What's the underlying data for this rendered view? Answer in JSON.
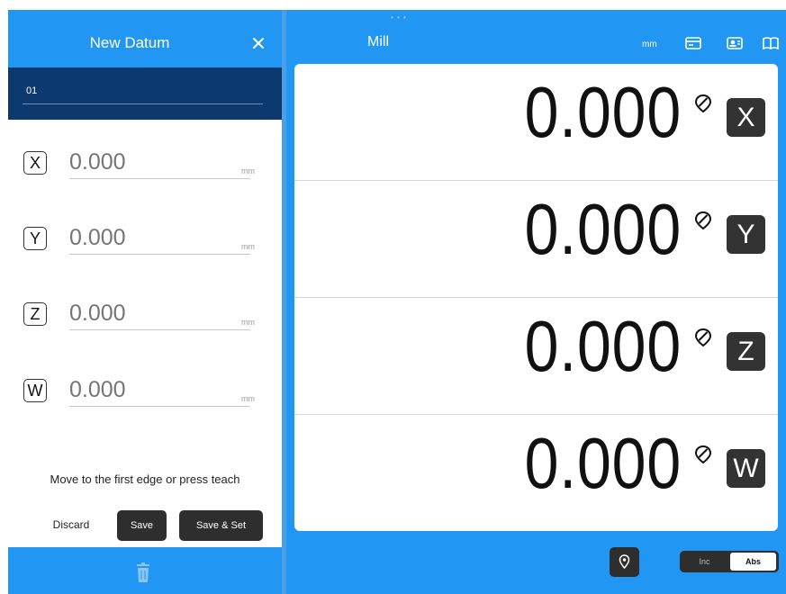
{
  "datum_panel": {
    "title": "New Datum",
    "name_value": "01",
    "axes": [
      {
        "label": "X",
        "placeholder": "0.000",
        "unit": "mm"
      },
      {
        "label": "Y",
        "placeholder": "0.000",
        "unit": "mm"
      },
      {
        "label": "Z",
        "placeholder": "0.000",
        "unit": "mm"
      },
      {
        "label": "W",
        "placeholder": "0.000",
        "unit": "mm"
      }
    ],
    "instruction": "Move to the first edge or press teach",
    "discard_label": "Discard",
    "save_label": "Save",
    "save_set_label": "Save & Set",
    "footer_icon": "trash-icon"
  },
  "main": {
    "title": "Mill",
    "unit_toggle": "mm",
    "toolbar_icons": [
      "card-icon",
      "camera-card-icon",
      "book-icon"
    ],
    "readouts": [
      {
        "value": "0.000",
        "axis": "X"
      },
      {
        "value": "0.000",
        "axis": "Y"
      },
      {
        "value": "0.000",
        "axis": "Z"
      },
      {
        "value": "0.000",
        "axis": "W"
      }
    ],
    "mode": {
      "inc_label": "Inc",
      "abs_label": "Abs",
      "selected": "Abs"
    },
    "pin_icon": "location-pin-icon"
  },
  "colors": {
    "header_blue": "#2196f3",
    "name_band": "#0d3a6e",
    "button_dark": "#2e2e2e"
  }
}
